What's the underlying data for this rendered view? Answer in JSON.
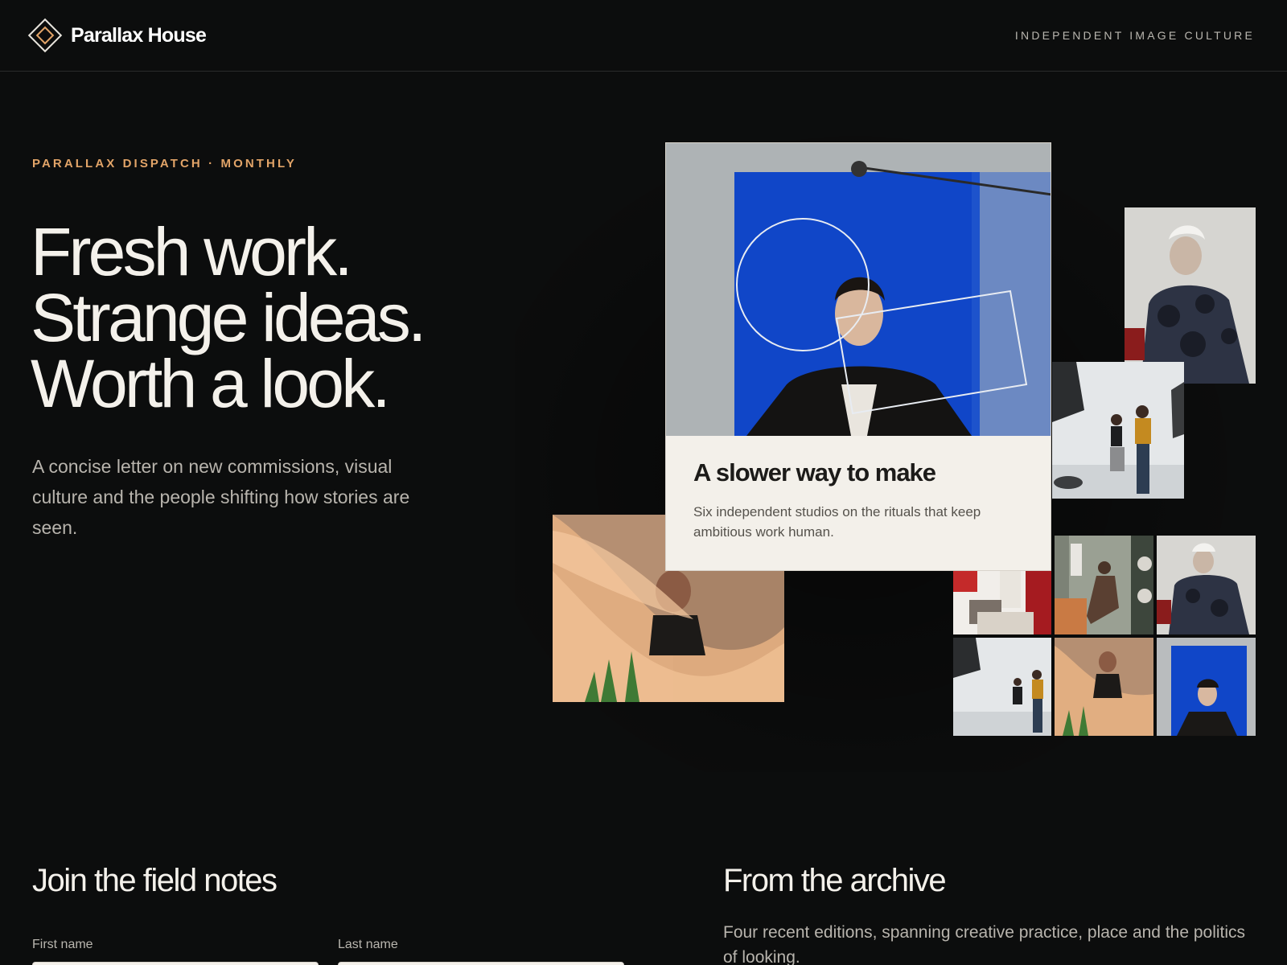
{
  "header": {
    "brand_name": "Parallax House",
    "tagline": "INDEPENDENT IMAGE CULTURE"
  },
  "hero": {
    "eyebrow": "PARALLAX DISPATCH · MONTHLY",
    "headline_lines": [
      "Fresh work.",
      "Strange ideas.",
      "Worth a look."
    ],
    "intro": "A concise letter on new commissions, visual culture and the people shifting how stories are seen."
  },
  "feature": {
    "title": "A slower way to make",
    "text": "Six independent studios on the rituals that keep ambitious work human."
  },
  "signup": {
    "title": "Join the field notes",
    "first_name_label": "First name",
    "last_name_label": "Last name"
  },
  "archive": {
    "title": "From the archive",
    "text": "Four recent editions, spanning creative practice, place and the politics of looking."
  },
  "colors": {
    "background": "#0c0d0d",
    "accent": "#e2a468",
    "card": "#f3f0ea",
    "studio_blue": "#1046c8"
  },
  "icons": [
    "diamond-logo-icon"
  ]
}
